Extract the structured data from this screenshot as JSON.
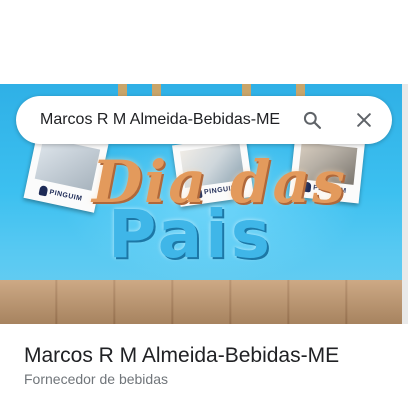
{
  "search": {
    "query": "Marcos R M Almeida-Bebidas-ME"
  },
  "icons": {
    "search": "search-icon",
    "close": "close-icon"
  },
  "hero_image": {
    "headline_line1": "Dia das",
    "headline_line2": "Pais",
    "photo_brand": "PINGUIM"
  },
  "place": {
    "name": "Marcos R M Almeida-Bebidas-ME",
    "category": "Fornecedor de bebidas"
  },
  "colors": {
    "sky": "#3cc0f0",
    "text_primary": "#202124",
    "text_secondary": "#70757a"
  }
}
